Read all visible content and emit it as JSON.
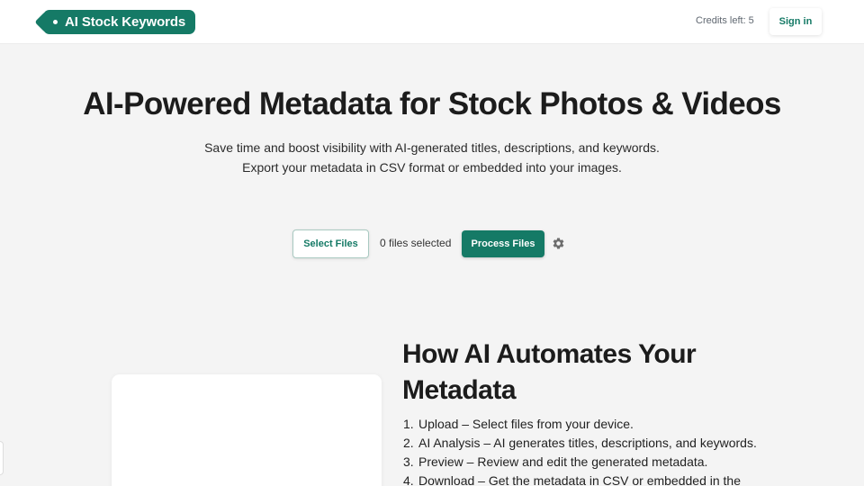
{
  "header": {
    "logo_text": "AI Stock Keywords",
    "credits": "Credits left: 5",
    "signin_label": "Sign in"
  },
  "hero": {
    "title": "AI-Powered Metadata for Stock Photos & Videos",
    "subtitle_line1": "Save time and boost visibility with AI-generated titles, descriptions, and keywords.",
    "subtitle_line2": "Export your metadata in CSV format or embedded into your images."
  },
  "controls": {
    "select_label": "Select Files",
    "files_selected": "0 files selected",
    "process_label": "Process Files",
    "settings_icon": "gear-icon"
  },
  "how": {
    "title": "How AI Automates Your Metadata",
    "steps": [
      {
        "num": "1.",
        "text": "Upload – Select files from your device."
      },
      {
        "num": "2.",
        "text": "AI Analysis – AI generates titles, descriptions, and keywords."
      },
      {
        "num": "3.",
        "text": "Preview – Review and edit the generated metadata."
      },
      {
        "num": "4.",
        "text": "Download – Get the metadata in CSV or embedded in the"
      }
    ]
  },
  "colors": {
    "brand": "#157a66",
    "background": "#f4f4f4"
  }
}
